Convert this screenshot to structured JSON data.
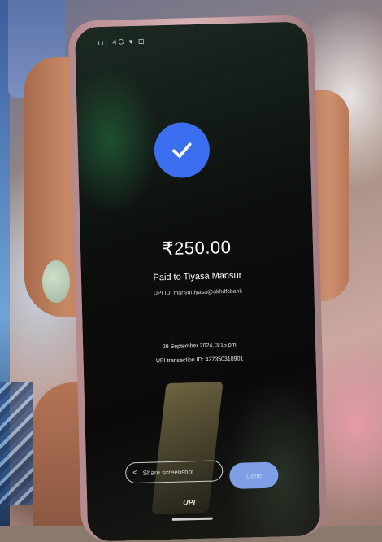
{
  "photo": {
    "status_bar": "ııı 4G ▾ ⊡",
    "payment": {
      "amount": "₹250.00",
      "paid_to": "Paid to Tiyasa Mansur",
      "upi_id": "UPI ID: mansurtiyasa@okhdfcbank",
      "datetime": "29 September 2024, 3:15 pm",
      "transaction_id": "UPI transaction ID: 427350310901"
    },
    "share_button_label": "Share screenshot",
    "done_button_label": "Done",
    "upi_logo": "UPI",
    "colors": {
      "check_circle": "#3b6ff0",
      "done_button": "#7e9fe6"
    }
  }
}
